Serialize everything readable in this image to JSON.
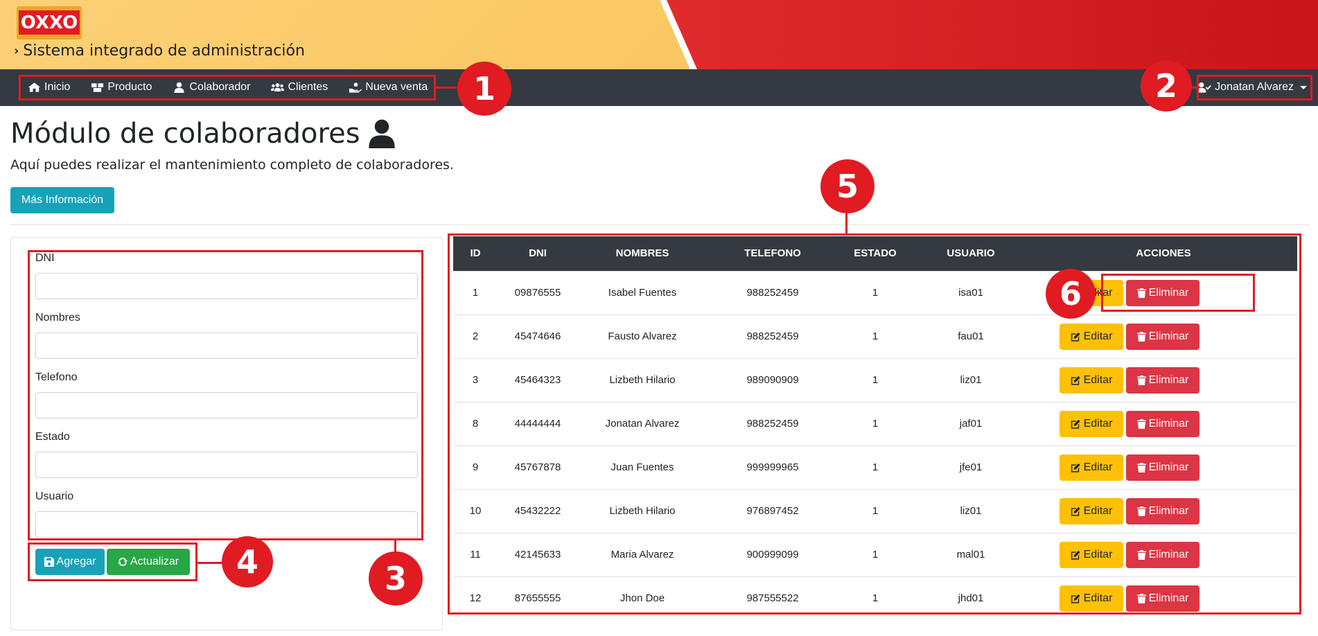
{
  "header": {
    "logo_text": "OXXO",
    "system_title": "Sistema integrado de administración"
  },
  "nav": {
    "items": [
      {
        "label": "Inicio",
        "icon": "home-icon"
      },
      {
        "label": "Producto",
        "icon": "boxes-icon"
      },
      {
        "label": "Colaborador",
        "icon": "user-icon"
      },
      {
        "label": "Clientes",
        "icon": "users-icon"
      },
      {
        "label": "Nueva venta",
        "icon": "hand-holding-icon"
      }
    ],
    "user_name": "Jonatan Alvarez"
  },
  "page": {
    "title": "Módulo de colaboradores",
    "description": "Aquí puedes realizar el mantenimiento completo de colaboradores.",
    "info_button": "Más Información"
  },
  "form": {
    "fields": [
      {
        "label": "DNI",
        "value": ""
      },
      {
        "label": "Nombres",
        "value": ""
      },
      {
        "label": "Telefono",
        "value": ""
      },
      {
        "label": "Estado",
        "value": ""
      },
      {
        "label": "Usuario",
        "value": ""
      }
    ],
    "add_button": "Agregar",
    "update_button": "Actualizar"
  },
  "table": {
    "headers": [
      "ID",
      "DNI",
      "NOMBRES",
      "TELEFONO",
      "ESTADO",
      "USUARIO",
      "ACCIONES"
    ],
    "rows": [
      [
        "1",
        "09876555",
        "Isabel Fuentes",
        "988252459",
        "1",
        "isa01"
      ],
      [
        "2",
        "45474646",
        "Fausto Alvarez",
        "988252459",
        "1",
        "fau01"
      ],
      [
        "3",
        "45464323",
        "Lizbeth Hilario",
        "989090909",
        "1",
        "liz01"
      ],
      [
        "8",
        "44444444",
        "Jonatan Alvarez",
        "988252459",
        "1",
        "jaf01"
      ],
      [
        "9",
        "45767878",
        "Juan Fuentes",
        "999999965",
        "1",
        "jfe01"
      ],
      [
        "10",
        "45432222",
        "Lizbeth Hilario",
        "976897452",
        "1",
        "liz01"
      ],
      [
        "11",
        "42145633",
        "Maria Alvarez",
        "900999099",
        "1",
        "mal01"
      ],
      [
        "12",
        "87655555",
        "Jhon Doe",
        "987555522",
        "1",
        "jhd01"
      ]
    ],
    "edit_label": "Editar",
    "delete_label": "Eliminar"
  },
  "annotations": [
    "1",
    "2",
    "3",
    "4",
    "5",
    "6"
  ],
  "colors": {
    "annotation_red": "#e11b22",
    "navbar": "#343a40",
    "info": "#17a2b8",
    "success": "#28a745",
    "warning": "#ffc107",
    "danger": "#dc3545"
  }
}
